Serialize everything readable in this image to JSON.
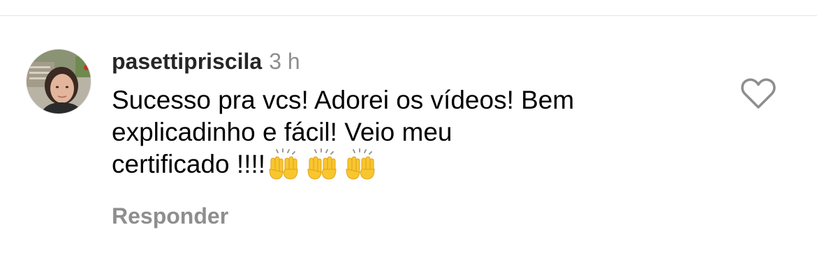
{
  "comment": {
    "username": "pasettipriscila",
    "time": "3 h",
    "text_line_1": "Sucesso pra vcs!  Adorei os vídeos! Bem",
    "text_line_2": "explicadinho e fácil! Veio meu",
    "text_line_3": "certificado !!!!",
    "emojis": [
      "raising-hands-emoji",
      "raising-hands-emoji",
      "raising-hands-emoji"
    ],
    "reply_label": "Responder",
    "like_icon": "heart-outline-icon",
    "avatar_icon": "avatar"
  },
  "colors": {
    "text": "#000000",
    "username": "#262626",
    "secondary": "#8e8e8e",
    "divider": "#e6e6e6",
    "emoji_yellow": "#f8c62e"
  }
}
